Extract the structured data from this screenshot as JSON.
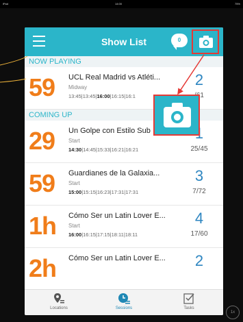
{
  "statusbar": {
    "left": "iPad",
    "center": "14:00",
    "right": "75%"
  },
  "header": {
    "title": "Show List",
    "chat_count": "0"
  },
  "sections": {
    "now_playing": "NOW PLAYING",
    "coming_up": "COMING UP"
  },
  "rows": [
    {
      "big": "59",
      "name": "UCL Real Madrid vs Atléti...",
      "sub": "Midway",
      "times": [
        "13:45",
        "13:45",
        "16:00",
        "16:15",
        "16:1"
      ],
      "seats": "2",
      "total": "/61"
    },
    {
      "big": "29",
      "name": "Un Golpe con Estilo Sub",
      "sub": "Start",
      "times": [
        "14:30",
        "14:45",
        "15:33",
        "16:21",
        "16:21"
      ],
      "seats": "1",
      "total": "25/45"
    },
    {
      "big": "59",
      "name": "Guardianes de la Galaxia...",
      "sub": "Start",
      "times": [
        "15:00",
        "15:15",
        "16:23",
        "17:31",
        "17:31"
      ],
      "seats": "3",
      "total": "7/72"
    },
    {
      "big": "1h",
      "name": "Cómo Ser un Latin Lover E...",
      "sub": "Start",
      "times": [
        "16:00",
        "16:15",
        "17:15",
        "18:11",
        "18:11"
      ],
      "seats": "4",
      "total": "17/60"
    },
    {
      "big": "2h",
      "name": "Cómo Ser un Latin Lover E...",
      "sub": "",
      "times": [],
      "seats": "2",
      "total": ""
    }
  ],
  "footer": {
    "tabs": [
      "Locations",
      "Sessions",
      "Tasks"
    ]
  },
  "corner_button": "1x",
  "colors": {
    "accent": "#2bb5c9",
    "orange": "#f07d1a",
    "seats_blue": "#2e86c1",
    "highlight": "#e53935"
  }
}
